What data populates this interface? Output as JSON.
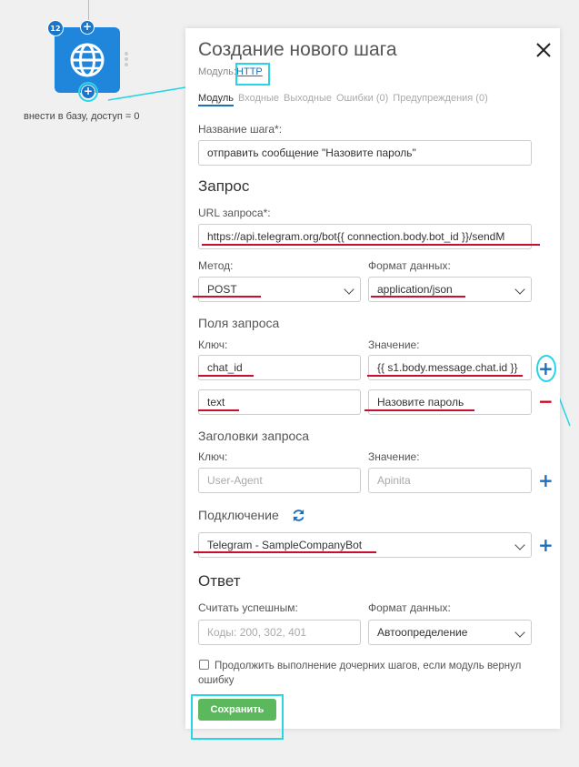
{
  "node": {
    "badge": "12",
    "plus_top": "+",
    "plus_bottom": "+",
    "label": "внести в базу, доступ = 0"
  },
  "panel": {
    "title": "Создание нового шага",
    "close": "✕",
    "module_prefix": "Модуль:",
    "module_name": "HTTP",
    "tabs": [
      {
        "label": "Модуль"
      },
      {
        "label": "Входные"
      },
      {
        "label": "Выходные"
      },
      {
        "label": "Ошибки (0)"
      },
      {
        "label": "Предупреждения (0)"
      }
    ],
    "step_name_label": "Название шага*:",
    "step_name_value": "отправить сообщение \"Назовите пароль\"",
    "request_title": "Запрос",
    "url_label": "URL запроса*:",
    "url_value": "https://api.telegram.org/bot{{ connection.body.bot_id }}/sendM",
    "method_label": "Метод:",
    "method_value": "POST",
    "format_label": "Формат данных:",
    "format_value": "application/json",
    "fields_title": "Поля запроса",
    "key_label": "Ключ:",
    "value_label": "Значение:",
    "fields": [
      {
        "key": "chat_id",
        "value": "{{ s1.body.message.chat.id }}"
      },
      {
        "key": "text",
        "value": "Назовите пароль"
      }
    ],
    "headers_title": "Заголовки запроса",
    "headers_key_label": "Ключ:",
    "headers_value_label": "Значение:",
    "header_key_placeholder": "User-Agent",
    "header_value_placeholder": "Apinita",
    "connection_title": "Подключение",
    "connection_value": "Telegram - SampleCompanyBot",
    "response_title": "Ответ",
    "success_label": "Считать успешным:",
    "success_placeholder": "Коды: 200, 302, 401",
    "response_format_label": "Формат данных:",
    "response_format_value": "Автоопределение",
    "continue_label": "Продолжить выполнение дочерних шагов, если модуль вернул ошибку",
    "save_label": "Сохранить",
    "plus": "+",
    "minus": "−"
  },
  "colors": {
    "node_blue": "#1f86db",
    "link_blue": "#1d6fb8",
    "highlight_cyan": "#28d4e6",
    "underline_red": "#c8102e",
    "save_green": "#5cb85c"
  }
}
